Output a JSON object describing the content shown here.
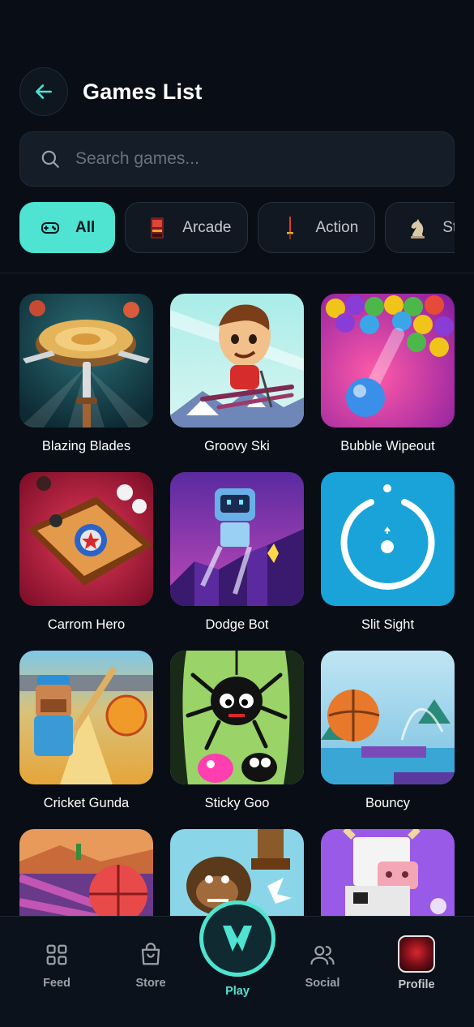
{
  "header": {
    "title": "Games List"
  },
  "search": {
    "placeholder": "Search games..."
  },
  "categories": [
    {
      "label": "All",
      "icon": "gamepad-icon",
      "active": true
    },
    {
      "label": "Arcade",
      "icon": "arcade-cabinet-icon",
      "active": false
    },
    {
      "label": "Action",
      "icon": "action-icon",
      "active": false
    },
    {
      "label": "St",
      "icon": "chess-knight-icon",
      "active": false
    }
  ],
  "games": [
    {
      "title": "Blazing Blades"
    },
    {
      "title": "Groovy Ski"
    },
    {
      "title": "Bubble Wipeout"
    },
    {
      "title": "Carrom Hero"
    },
    {
      "title": "Dodge Bot"
    },
    {
      "title": "Slit Sight"
    },
    {
      "title": "Cricket Gunda"
    },
    {
      "title": "Sticky Goo"
    },
    {
      "title": "Bouncy"
    },
    {
      "title": ""
    },
    {
      "title": ""
    },
    {
      "title": ""
    }
  ],
  "nav": {
    "feed": "Feed",
    "store": "Store",
    "play": "Play",
    "social": "Social",
    "profile": "Profile"
  },
  "colors": {
    "accent": "#4fe3d1",
    "background": "#080d16",
    "surface": "#151d28"
  }
}
